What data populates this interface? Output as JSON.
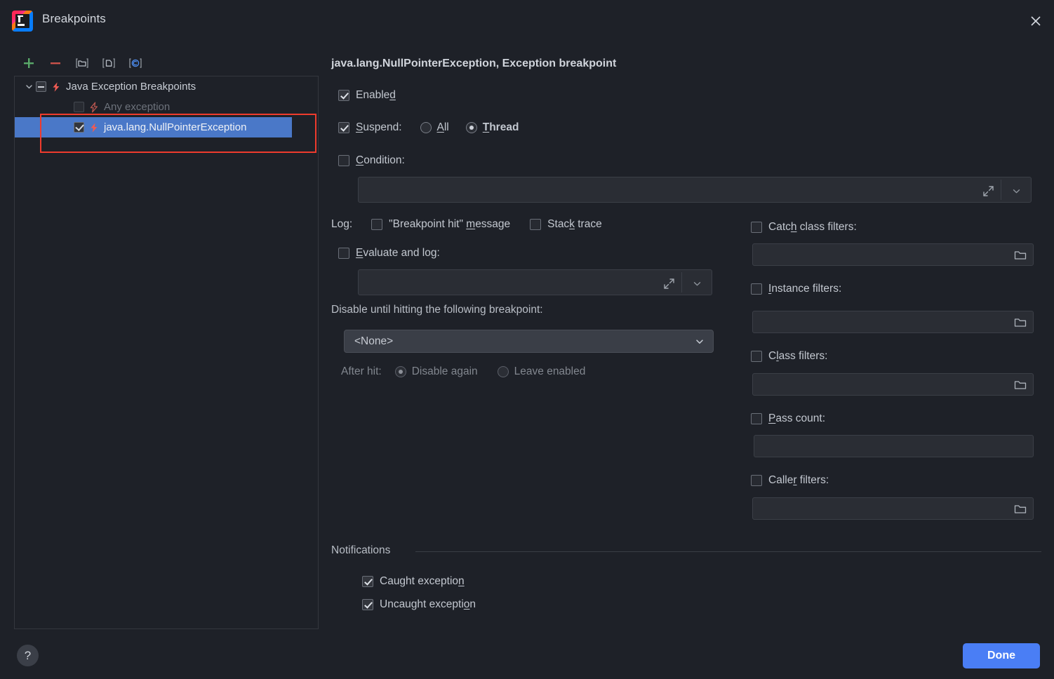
{
  "window": {
    "title": "Breakpoints",
    "logo_icon": "intellij-idea-logo",
    "close_icon": "close-icon"
  },
  "toolbar": {
    "buttons": [
      {
        "name": "add-breakpoint-button",
        "icon": "plus-icon"
      },
      {
        "name": "remove-breakpoint-button",
        "icon": "minus-icon"
      },
      {
        "name": "group-by-package-button",
        "icon": "folder-brackets-icon"
      },
      {
        "name": "group-by-file-button",
        "icon": "file-brackets-icon"
      },
      {
        "name": "group-by-class-button",
        "icon": "class-brackets-icon"
      }
    ]
  },
  "tree": {
    "nodes": [
      {
        "label": "Java Exception Breakpoints",
        "icon": "lightning-bolt-icon",
        "checkbox": "indeterminate",
        "expanded": true,
        "twisty": "chevron-down-icon",
        "state": "normal"
      },
      {
        "label": "Any exception",
        "icon": "lightning-bolt-outline-icon",
        "checkbox": "unchecked",
        "state": "dim"
      },
      {
        "label": "java.lang.NullPointerException",
        "icon": "lightning-bolt-icon",
        "checkbox": "checked",
        "state": "selected"
      }
    ]
  },
  "help": {
    "label": "?",
    "icon": "help-icon"
  },
  "detail": {
    "title": "java.lang.NullPointerException, Exception breakpoint",
    "enabled": {
      "label_pre": "Enable",
      "label_mn": "d",
      "label_post": "",
      "checked": true
    },
    "suspend": {
      "label_pre": "",
      "label_mn": "S",
      "label_post": "uspend:",
      "checked": true,
      "options": [
        {
          "label_pre": "",
          "label_mn": "A",
          "label_post": "ll",
          "selected": false,
          "bold": false
        },
        {
          "label_pre": "",
          "label_mn": "T",
          "label_post": "hread",
          "selected": true,
          "bold": true
        }
      ]
    },
    "condition": {
      "label_pre": "",
      "label_mn": "C",
      "label_post": "ondition:",
      "checked": false,
      "value": "",
      "expand_icon": "expand-diagonal-icon",
      "dropdown_icon": "chevron-down-icon"
    },
    "log": {
      "label": "Log:",
      "items": [
        {
          "label_pre": "\"Breakpoint hit\" ",
          "label_mn": "m",
          "label_post": "essage",
          "checked": false
        },
        {
          "label_pre": "Stac",
          "label_mn": "k",
          "label_post": " trace",
          "checked": false
        }
      ]
    },
    "evaluate_and_log": {
      "label_pre": "",
      "label_mn": "E",
      "label_post": "valuate and log:",
      "checked": false,
      "value": "",
      "expand_icon": "expand-diagonal-icon",
      "dropdown_icon": "chevron-down-icon"
    },
    "disable_until": {
      "label": "Disable until hitting the following breakpoint:",
      "selected": "<None>",
      "dropdown_icon": "chevron-down-icon"
    },
    "after_hit": {
      "label": "After hit:",
      "options": [
        {
          "label": "Disable again",
          "selected": true
        },
        {
          "label": "Leave enabled",
          "selected": false
        }
      ]
    },
    "filters": [
      {
        "name": "catch-class-filters",
        "label_pre": "Catc",
        "label_mn": "h",
        "label_post": " class filters:",
        "checked": false,
        "value": "",
        "browse_icon": "folder-icon"
      },
      {
        "name": "instance-filters",
        "label_pre": "",
        "label_mn": "I",
        "label_post": "nstance filters:",
        "checked": false,
        "value": "",
        "browse_icon": "folder-icon"
      },
      {
        "name": "class-filters",
        "label_pre": "C",
        "label_mn": "l",
        "label_post": "ass filters:",
        "checked": false,
        "value": "",
        "browse_icon": "folder-icon"
      },
      {
        "name": "pass-count",
        "label_pre": "",
        "label_mn": "P",
        "label_post": "ass count:",
        "checked": false,
        "value": "",
        "browse_icon": ""
      },
      {
        "name": "caller-filters",
        "label_pre": "Calle",
        "label_mn": "r",
        "label_post": " filters:",
        "checked": false,
        "value": "",
        "browse_icon": "folder-icon"
      }
    ],
    "notifications": {
      "title": "Notifications",
      "items": [
        {
          "label_pre": "Caught exceptio",
          "label_mn": "n",
          "label_post": "",
          "checked": true
        },
        {
          "label_pre": "Uncaught excepti",
          "label_mn": "o",
          "label_post": "n",
          "checked": true
        }
      ]
    }
  },
  "footer": {
    "done_label": "Done"
  },
  "colors": {
    "background": "#1e2128",
    "selection": "#4a78c8",
    "accent": "#4a7ef5",
    "annotation": "#ef3b2d",
    "bolt": "#f05b53"
  }
}
